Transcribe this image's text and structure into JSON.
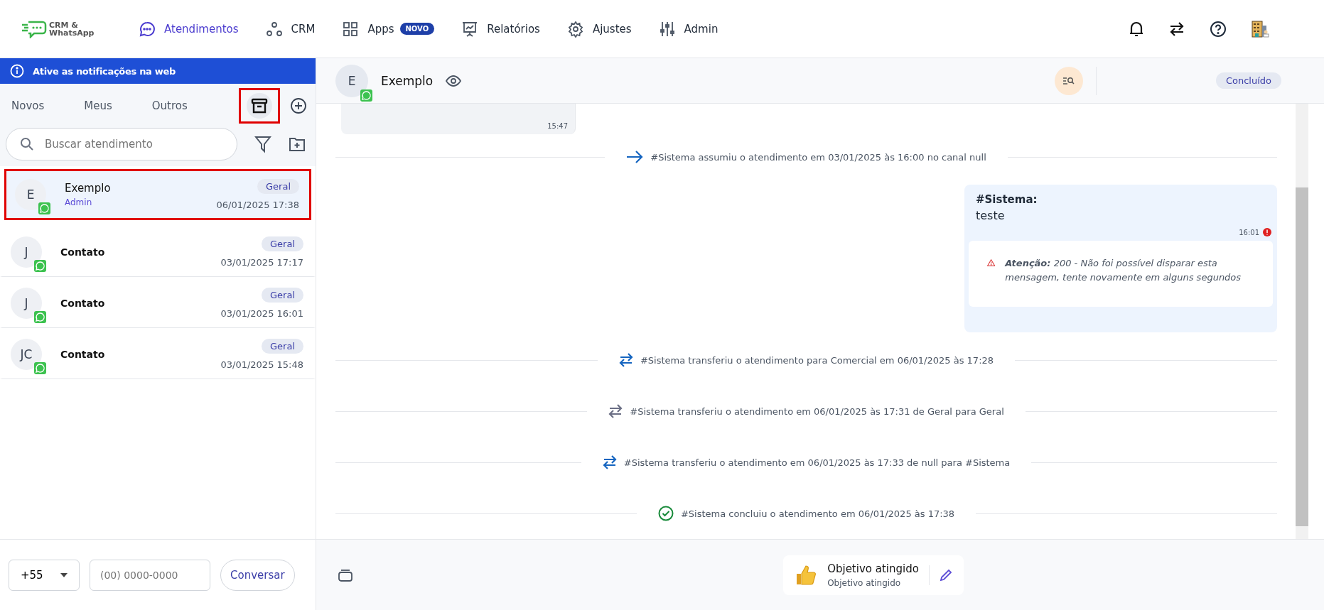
{
  "logo": {
    "line1": "CRM &",
    "line2": "WhatsApp"
  },
  "nav": [
    {
      "label": "Atendimentos",
      "kind": "chat",
      "selected": true
    },
    {
      "label": "CRM",
      "kind": "nodes",
      "selected": false
    },
    {
      "label": "Apps",
      "kind": "grid",
      "selected": false,
      "badge": "NOVO"
    },
    {
      "label": "Relatórios",
      "kind": "chart",
      "selected": false
    },
    {
      "label": "Ajustes",
      "kind": "gear",
      "selected": false
    },
    {
      "label": "Admin",
      "kind": "sliders",
      "selected": false
    }
  ],
  "notification_banner": "Ative as notificações na web",
  "tabs": [
    {
      "label": "Novos",
      "selected": false
    },
    {
      "label": "Meus",
      "selected": false
    },
    {
      "label": "Outros",
      "selected": false
    }
  ],
  "archive_button": {
    "highlighted": true
  },
  "search": {
    "placeholder": "Buscar atendimento"
  },
  "conversations": [
    {
      "initials": "E",
      "name": "Exemplo",
      "subtitle": "Admin",
      "tag": "Geral",
      "datetime": "06/01/2025 17:38",
      "selected": true,
      "highlighted": true,
      "unread": false
    },
    {
      "initials": "J",
      "name": "Contato",
      "tag": "Geral",
      "datetime": "03/01/2025 17:17",
      "selected": false,
      "highlighted": false,
      "unread": true
    },
    {
      "initials": "J",
      "name": "Contato",
      "tag": "Geral",
      "datetime": "03/01/2025 16:01",
      "selected": false,
      "highlighted": false,
      "unread": true
    },
    {
      "initials": "JC",
      "name": "Contato",
      "tag": "Geral",
      "datetime": "03/01/2025 15:48",
      "selected": false,
      "highlighted": false,
      "unread": true
    }
  ],
  "phone": {
    "country_code": "+55",
    "placeholder": "(00) 0000-0000",
    "button": "Conversar"
  },
  "chat": {
    "header": {
      "initials": "E",
      "name": "Exemplo",
      "status": "Concluído"
    },
    "timeline": [
      {
        "kind": "incoming",
        "time": "15:47"
      },
      {
        "kind": "assumed",
        "color": "#1565c0",
        "text": "#Sistema assumiu o atendimento em 03/01/2025 às 16:00 no canal null"
      },
      {
        "kind": "outgoing",
        "author": "#Sistema:",
        "text": "teste",
        "time": "16:01",
        "error": true,
        "warning": "**Atenção:** 200 - Não foi possível disparar esta mensagem, tente novamente em alguns segundos"
      },
      {
        "kind": "transfer",
        "color": "#1565c0",
        "text": "#Sistema transferiu o atendimento para Comercial em 06/01/2025 às 17:28"
      },
      {
        "kind": "transfer",
        "color": "#6b6f85",
        "text": "#Sistema transferiu o atendimento em 06/01/2025 às 17:31 de Geral para Geral"
      },
      {
        "kind": "transfer",
        "color": "#1565c0",
        "text": "#Sistema transferiu o atendimento em 06/01/2025 às 17:33 de null para #Sistema"
      },
      {
        "kind": "done",
        "color": "#188a3a",
        "text": "#Sistema concluiu o atendimento em 06/01/2025 às 17:38"
      }
    ]
  },
  "footer": {
    "outcome_title": "Objetivo atingido",
    "outcome_subtitle": "Objetivo atingido"
  }
}
